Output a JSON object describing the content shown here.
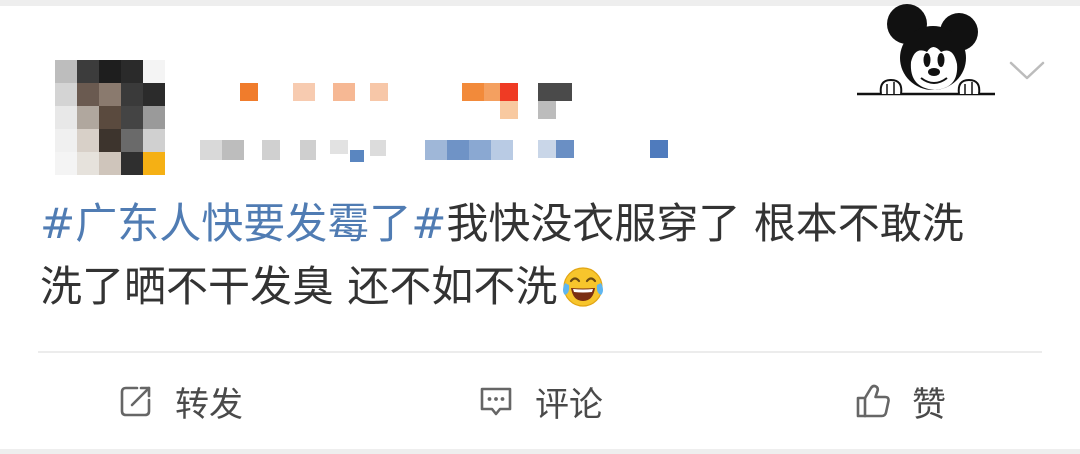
{
  "header": {
    "avatar_icon": "pixelated-avatar-icon",
    "decoration_icon": "mickey-mouse-icon",
    "menu_icon": "chevron-down-icon"
  },
  "post": {
    "hashtag": "#广东人快要发霉了#",
    "body_lines": [
      "我快没衣服穿了 根本不敢洗",
      "洗了晒不干发臭 还不如不洗"
    ],
    "emoji_icon": "face-with-tears-of-joy-icon"
  },
  "actions": [
    {
      "label": "转发",
      "icon": "repost-icon"
    },
    {
      "label": "评论",
      "icon": "comment-icon"
    },
    {
      "label": "赞",
      "icon": "like-icon"
    }
  ],
  "colors": {
    "background": "#ffffff",
    "text": "#333333",
    "hashtag": "#507cb3",
    "action": "#4a4a4a",
    "icon": "#666666",
    "divider": "#ececec",
    "strip": "#eeeeee"
  }
}
